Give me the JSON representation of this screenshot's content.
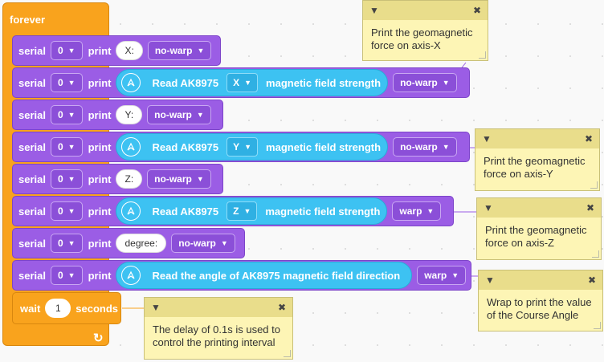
{
  "forever_label": "forever",
  "wait_block": {
    "label": "wait",
    "value": "1",
    "unit": "seconds"
  },
  "blocks": [
    {
      "serial": "serial",
      "port": "0",
      "print": "print",
      "text": "X:",
      "mode": "no-warp"
    },
    {
      "serial": "serial",
      "port": "0",
      "print": "print",
      "sensor_label": "Read AK8975",
      "axis": "X",
      "sensor_suffix": "magnetic field strength",
      "mode": "no-warp"
    },
    {
      "serial": "serial",
      "port": "0",
      "print": "print",
      "text": "Y:",
      "mode": "no-warp"
    },
    {
      "serial": "serial",
      "port": "0",
      "print": "print",
      "sensor_label": "Read AK8975",
      "axis": "Y",
      "sensor_suffix": "magnetic field strength",
      "mode": "no-warp"
    },
    {
      "serial": "serial",
      "port": "0",
      "print": "print",
      "text": "Z:",
      "mode": "no-warp"
    },
    {
      "serial": "serial",
      "port": "0",
      "print": "print",
      "sensor_label": "Read AK8975",
      "axis": "Z",
      "sensor_suffix": "magnetic field strength",
      "mode": "warp"
    },
    {
      "serial": "serial",
      "port": "0",
      "print": "print",
      "text": "degree:",
      "mode": "no-warp"
    },
    {
      "serial": "serial",
      "port": "0",
      "print": "print",
      "sensor_label": "Read the angle of AK8975 magnetic field direction",
      "mode": "warp"
    }
  ],
  "notes": [
    {
      "text": "Print the geomagnetic\nforce on axis-X"
    },
    {
      "text": "Print the geomagnetic\nforce on axis-Y"
    },
    {
      "text": "Print the geomagnetic\nforce on axis-Z"
    },
    {
      "text": "Wrap to print the value\nof the Course Angle"
    },
    {
      "text": "The delay of 0.1s is used to\ncontrol the printing interval"
    }
  ],
  "icons": {
    "collapse": "caret-down-icon",
    "close": "close-icon",
    "compass": "compass-icon",
    "loop": "loop-arrow-icon"
  }
}
